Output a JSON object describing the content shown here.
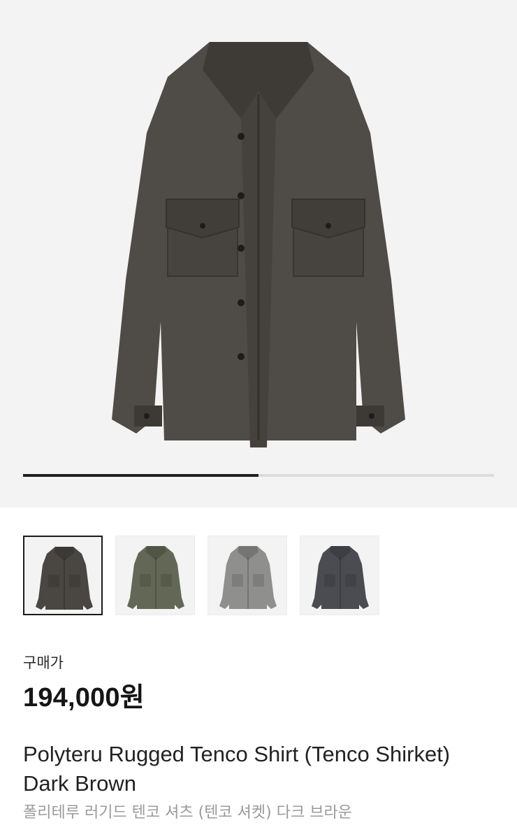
{
  "product": {
    "price_label": "구매가",
    "price": "194,000원",
    "title": "Polyteru Rugged Tenco Shirt (Tenco Shirket) Dark Brown",
    "subtitle": "폴리테루 러기드 텐코 셔츠 (텐코 셔켓) 다크 브라운",
    "image": {
      "icon": "shirt-jacket-image",
      "color": "#4f4b46",
      "background": "#f3f3f3"
    }
  },
  "gallery": {
    "progress": 0.5,
    "track_color": "#dcdcdc",
    "fill_color": "#1f1f1f"
  },
  "thumbnails": [
    {
      "color": "#4a4743",
      "selected": true
    },
    {
      "color": "#626855",
      "selected": false
    },
    {
      "color": "#8f8f8d",
      "selected": false
    },
    {
      "color": "#4b4c52",
      "selected": false
    }
  ]
}
